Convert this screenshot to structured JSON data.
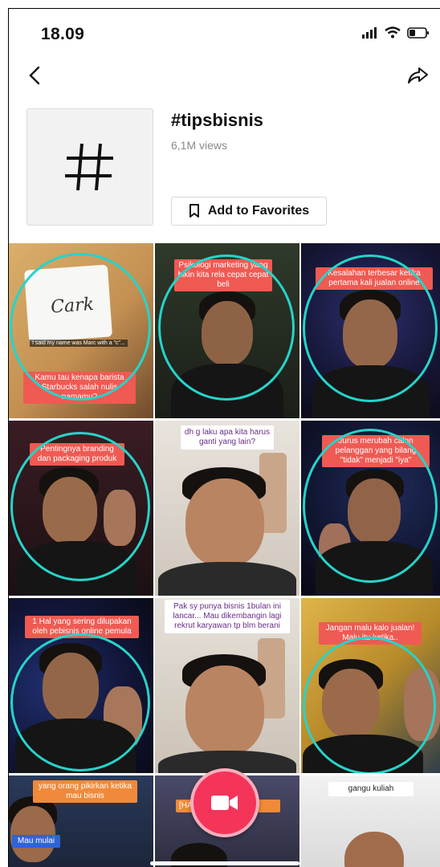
{
  "status_bar": {
    "time": "18.09"
  },
  "nav": {
    "back_icon": "chevron-left-icon",
    "share_icon": "share-arrow-icon"
  },
  "hashtag": {
    "thumb_symbol": "#",
    "title": "#tipsbisnis",
    "views": "6,1M views",
    "favorites_label": "Add to Favorites"
  },
  "accent": {
    "ring": "#27d3c9",
    "caption_bg": "#ef5a52",
    "record": "#f5345a"
  },
  "videos": [
    {
      "caption": "Kamu tau kenapa barista Starbucks salah nulis namamu?",
      "cup_text": "Cark",
      "cup_note": "I said my name was Marc with a \"c\"..."
    },
    {
      "caption": "Psikologi marketing yang bikin kita rela cepat cepat beli"
    },
    {
      "caption": "Kesalahan terbesar ketika pertama kali jualan online"
    },
    {
      "caption": "Pentingnya branding dan packaging produk"
    },
    {
      "caption": "dh g laku apa kita harus ganti yang lain?"
    },
    {
      "caption": "Jurus merubah calon pelanggan yang bilang \"tidak\" menjadi \"iya\""
    },
    {
      "caption": "1 Hal yang sering dilupakan oleh pebisnis online pemula"
    },
    {
      "caption": "Pak sy punya bisnis 1bulan ini lancar... Mau dikembangin lagi rekrut karyawan tp blm berani"
    },
    {
      "caption": "Jangan malu kalo jualan! Malu itu ketika.."
    },
    {
      "caption": "yang orang pikirkan ketika mau bisnis",
      "badge": "Mau mulai"
    },
    {
      "caption": "[HA..."
    },
    {
      "caption": "gangu kuliah"
    }
  ]
}
